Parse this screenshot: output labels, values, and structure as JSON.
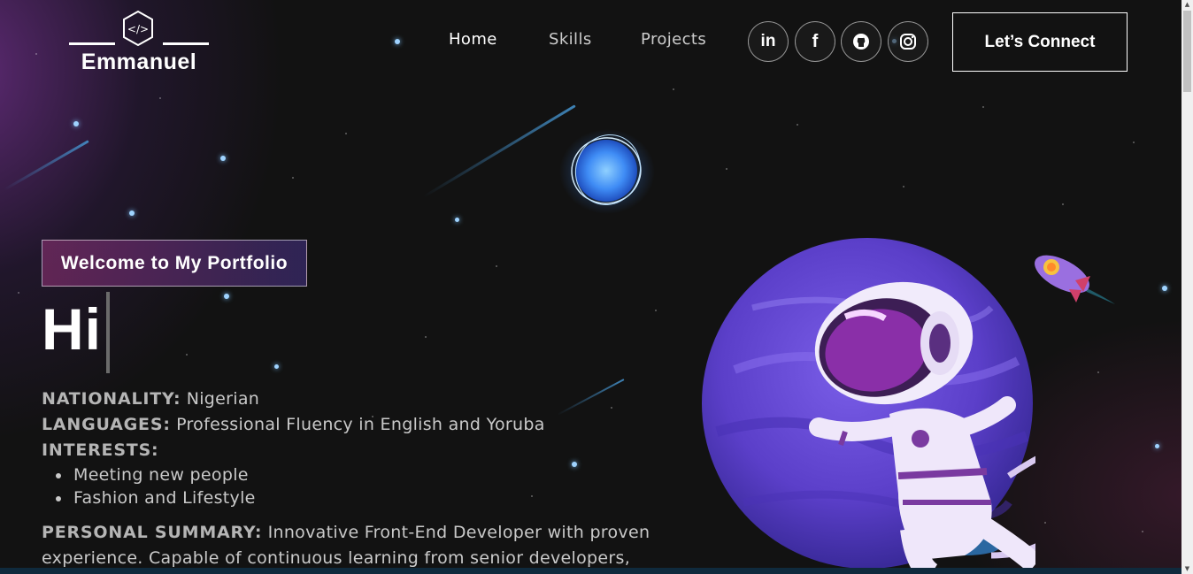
{
  "brand": {
    "name": "Emmanuel",
    "logo_symbol": "</>"
  },
  "nav": {
    "links": [
      {
        "label": "Home",
        "active": true
      },
      {
        "label": "Skills",
        "active": false
      },
      {
        "label": "Projects",
        "active": false
      }
    ],
    "socials": [
      {
        "icon": "linkedin-icon",
        "glyph": "in"
      },
      {
        "icon": "facebook-icon",
        "glyph": "f"
      },
      {
        "icon": "github-icon",
        "glyph": ""
      },
      {
        "icon": "instagram-icon",
        "glyph": ""
      }
    ],
    "cta_label": "Let’s Connect"
  },
  "hero": {
    "tagline": "Welcome to My Portfolio",
    "greeting": "Hi",
    "nationality_label": "NATIONALITY:",
    "nationality_value": "Nigerian",
    "languages_label": "LANGUAGES:",
    "languages_value": "Professional Fluency in English and Yoruba",
    "interests_label": "INTERESTS:",
    "interests": [
      "Meeting new people",
      "Fashion and Lifestyle"
    ],
    "summary_label": "PERSONAL SUMMARY:",
    "summary_value": "Innovative Front-End Developer with proven experience. Capable of continuous learning from senior developers,"
  },
  "colors": {
    "background": "#121212",
    "accent_purple": "#6b3fa0",
    "accent_pink": "#963278",
    "star_blue": "#9fd3ff"
  }
}
